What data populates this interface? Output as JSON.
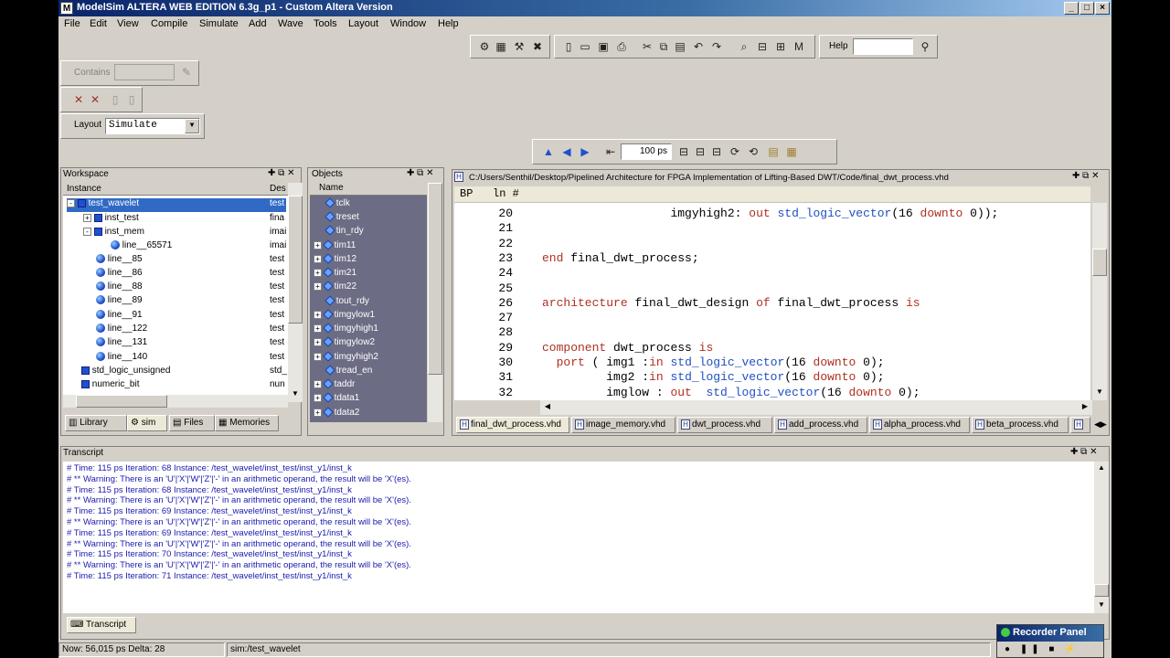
{
  "window": {
    "title": "ModelSim ALTERA WEB EDITION 6.3g_p1 - Custom Altera Version"
  },
  "menu": [
    "File",
    "Edit",
    "View",
    "Compile",
    "Simulate",
    "Add",
    "Wave",
    "Tools",
    "Layout",
    "Window",
    "Help"
  ],
  "toolbar": {
    "contains_label": "Contains",
    "contains_value": "",
    "layout_label": "Layout",
    "layout_value": "Simulate",
    "help_label": "Help",
    "help_value": "",
    "run_length": "100 ps"
  },
  "workspace": {
    "title": "Workspace",
    "col_instance": "Instance",
    "col_design": "Des",
    "rows": [
      {
        "name": "test_wavelet",
        "design": "test",
        "icon": "square",
        "expander": "-",
        "selected": true
      },
      {
        "name": "inst_test",
        "design": "fina",
        "icon": "square",
        "expander": "+"
      },
      {
        "name": "inst_mem",
        "design": "imai",
        "icon": "square",
        "expander": "-"
      },
      {
        "name": "line__65571",
        "design": "imai",
        "icon": "ball",
        "expander": ""
      },
      {
        "name": "line__85",
        "design": "test",
        "icon": "ball",
        "expander": ""
      },
      {
        "name": "line__86",
        "design": "test",
        "icon": "ball",
        "expander": ""
      },
      {
        "name": "line__88",
        "design": "test",
        "icon": "ball",
        "expander": ""
      },
      {
        "name": "line__89",
        "design": "test",
        "icon": "ball",
        "expander": ""
      },
      {
        "name": "line__91",
        "design": "test",
        "icon": "ball",
        "expander": ""
      },
      {
        "name": "line__122",
        "design": "test",
        "icon": "ball",
        "expander": ""
      },
      {
        "name": "line__131",
        "design": "test",
        "icon": "ball",
        "expander": ""
      },
      {
        "name": "line__140",
        "design": "test",
        "icon": "ball",
        "expander": ""
      },
      {
        "name": "std_logic_unsigned",
        "design": "std_",
        "icon": "square",
        "expander": ""
      },
      {
        "name": "numeric_bit",
        "design": "nun",
        "icon": "square",
        "expander": ""
      }
    ],
    "tabs": [
      "Library",
      "sim",
      "Files",
      "Memories"
    ]
  },
  "objects": {
    "title": "Objects",
    "col_name": "Name",
    "items": [
      {
        "name": "tclk",
        "expandable": false
      },
      {
        "name": "treset",
        "expandable": false
      },
      {
        "name": "tin_rdy",
        "expandable": false
      },
      {
        "name": "tim11",
        "expandable": true
      },
      {
        "name": "tim12",
        "expandable": true
      },
      {
        "name": "tim21",
        "expandable": true
      },
      {
        "name": "tim22",
        "expandable": true
      },
      {
        "name": "tout_rdy",
        "expandable": false
      },
      {
        "name": "timgylow1",
        "expandable": true
      },
      {
        "name": "timgyhigh1",
        "expandable": true
      },
      {
        "name": "timgylow2",
        "expandable": true
      },
      {
        "name": "timgyhigh2",
        "expandable": true
      },
      {
        "name": "tread_en",
        "expandable": false
      },
      {
        "name": "taddr",
        "expandable": true
      },
      {
        "name": "tdata1",
        "expandable": true
      },
      {
        "name": "tdata2",
        "expandable": true
      }
    ]
  },
  "editor": {
    "path": "C:/Users/Senthil/Desktop/Pipelined Architecture for FPGA Implementation of Lifting-Based DWT/Code/final_dwt_process.vhd",
    "col_bp": "BP",
    "col_ln": "ln #",
    "lines": [
      {
        "n": "20",
        "text": "                  imgyhigh2: out std_logic_vector(16 downto 0));"
      },
      {
        "n": "21",
        "text": ""
      },
      {
        "n": "22",
        "text": ""
      },
      {
        "n": "23",
        "text": "end final_dwt_process;"
      },
      {
        "n": "24",
        "text": ""
      },
      {
        "n": "25",
        "text": ""
      },
      {
        "n": "26",
        "text": "architecture final_dwt_design of final_dwt_process is"
      },
      {
        "n": "27",
        "text": ""
      },
      {
        "n": "28",
        "text": ""
      },
      {
        "n": "29",
        "text": "component dwt_process is"
      },
      {
        "n": "30",
        "text": "  port ( img1 :in std_logic_vector(16 downto 0);"
      },
      {
        "n": "31",
        "text": "         img2 :in std_logic_vector(16 downto 0);"
      },
      {
        "n": "32",
        "text": "         imglow : out  std_logic_vector(16 downto 0);"
      }
    ],
    "tabs": [
      "final_dwt_process.vhd",
      "image_memory.vhd",
      "dwt_process.vhd",
      "add_process.vhd",
      "alpha_process.vhd",
      "beta_process.vhd",
      "H"
    ]
  },
  "transcript": {
    "title": "Transcript",
    "lines": [
      "#    Time: 115 ps  Iteration: 68  Instance: /test_wavelet/inst_test/inst_y1/inst_k",
      "# ** Warning: There is an 'U'|'X'|'W'|'Z'|'-' in an arithmetic operand, the result will be 'X'(es).",
      "#    Time: 115 ps  Iteration: 68  Instance: /test_wavelet/inst_test/inst_y1/inst_k",
      "# ** Warning: There is an 'U'|'X'|'W'|'Z'|'-' in an arithmetic operand, the result will be 'X'(es).",
      "#    Time: 115 ps  Iteration: 69  Instance: /test_wavelet/inst_test/inst_y1/inst_k",
      "# ** Warning: There is an 'U'|'X'|'W'|'Z'|'-' in an arithmetic operand, the result will be 'X'(es).",
      "#    Time: 115 ps  Iteration: 69  Instance: /test_wavelet/inst_test/inst_y1/inst_k",
      "# ** Warning: There is an 'U'|'X'|'W'|'Z'|'-' in an arithmetic operand, the result will be 'X'(es).",
      "#    Time: 115 ps  Iteration: 70  Instance: /test_wavelet/inst_test/inst_y1/inst_k",
      "# ** Warning: There is an 'U'|'X'|'W'|'Z'|'-' in an arithmetic operand, the result will be 'X'(es).",
      "#    Time: 115 ps  Iteration: 71  Instance: /test_wavelet/inst_test/inst_y1/inst_k"
    ],
    "tab": "Transcript"
  },
  "status": {
    "now": "Now: 56,015 ps  Delta: 28",
    "context": "sim:/test_wavelet"
  },
  "recorder": {
    "title": "Recorder Panel"
  }
}
